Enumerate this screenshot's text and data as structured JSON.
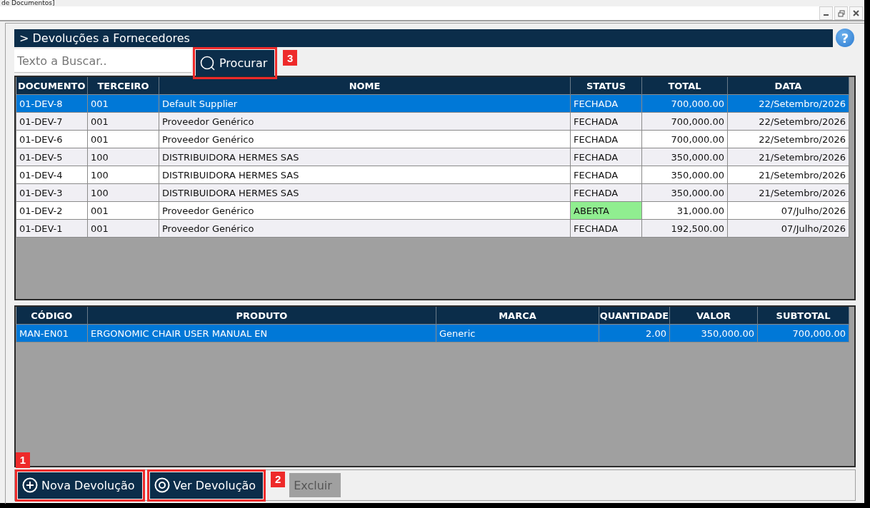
{
  "window": {
    "title": "de Documentos]",
    "controls": [
      {
        "kind": "minimize"
      },
      {
        "kind": "restore"
      },
      {
        "kind": "close"
      }
    ]
  },
  "header": {
    "title": "> Devoluções a Fornecedores",
    "help": "?"
  },
  "search": {
    "placeholder": "Texto a Buscar..",
    "button": {
      "label": "Procurar",
      "annotation": "3"
    }
  },
  "documents": {
    "columns": [
      {
        "label": "DOCUMENTO",
        "kind": "text"
      },
      {
        "label": "TERCEIRO",
        "kind": "text"
      },
      {
        "label": "NOME",
        "kind": "text"
      },
      {
        "label": "STATUS",
        "kind": "text"
      },
      {
        "label": "TOTAL",
        "kind": "number"
      },
      {
        "label": "DATA",
        "kind": "number"
      }
    ],
    "rows": [
      {
        "selected": true,
        "cells": [
          "01-DEV-8",
          "001",
          "Default Supplier",
          "FECHADA",
          "700,000.00",
          "22/Setembro/2026"
        ],
        "status_highlighted": false
      },
      {
        "selected": false,
        "cells": [
          "01-DEV-7",
          "001",
          "Proveedor Genérico",
          "FECHADA",
          "700,000.00",
          "22/Setembro/2026"
        ],
        "status_highlighted": false
      },
      {
        "selected": false,
        "cells": [
          "01-DEV-6",
          "001",
          "Proveedor Genérico",
          "FECHADA",
          "700,000.00",
          "22/Setembro/2026"
        ],
        "status_highlighted": false
      },
      {
        "selected": false,
        "cells": [
          "01-DEV-5",
          "100",
          "DISTRIBUIDORA HERMES SAS",
          "FECHADA",
          "350,000.00",
          "21/Setembro/2026"
        ],
        "status_highlighted": false
      },
      {
        "selected": false,
        "cells": [
          "01-DEV-4",
          "100",
          "DISTRIBUIDORA HERMES SAS",
          "FECHADA",
          "350,000.00",
          "21/Setembro/2026"
        ],
        "status_highlighted": false
      },
      {
        "selected": false,
        "cells": [
          "01-DEV-3",
          "100",
          "DISTRIBUIDORA HERMES SAS",
          "FECHADA",
          "350,000.00",
          "21/Setembro/2026"
        ],
        "status_highlighted": false
      },
      {
        "selected": false,
        "cells": [
          "01-DEV-2",
          "001",
          "Proveedor Genérico",
          "ABERTA",
          "31,000.00",
          "07/Julho/2026"
        ],
        "status_highlighted": true
      },
      {
        "selected": false,
        "cells": [
          "01-DEV-1",
          "001",
          "Proveedor Genérico",
          "FECHADA",
          "192,500.00",
          "07/Julho/2026"
        ],
        "status_highlighted": false
      }
    ]
  },
  "items": {
    "columns": [
      {
        "label": "CÓDIGO",
        "kind": "text"
      },
      {
        "label": "PRODUTO",
        "kind": "text"
      },
      {
        "label": "MARCA",
        "kind": "text"
      },
      {
        "label": "QUANTIDADE",
        "kind": "number"
      },
      {
        "label": "VALOR",
        "kind": "number"
      },
      {
        "label": "SUBTOTAL",
        "kind": "number"
      }
    ],
    "rows": [
      {
        "selected": true,
        "cells": [
          "MAN-EN01",
          "ERGONOMIC CHAIR USER MANUAL EN",
          "Generic",
          "2.00",
          "350,000.00",
          "700,000.00"
        ]
      }
    ]
  },
  "actions": [
    {
      "kind": "add",
      "label": "Nova Devolução",
      "disabled": false,
      "annotation": "1"
    },
    {
      "kind": "view",
      "label": "Ver Devolução",
      "disabled": false,
      "annotation": "2"
    },
    {
      "kind": "delete",
      "label": "Excluir",
      "disabled": true
    }
  ]
}
